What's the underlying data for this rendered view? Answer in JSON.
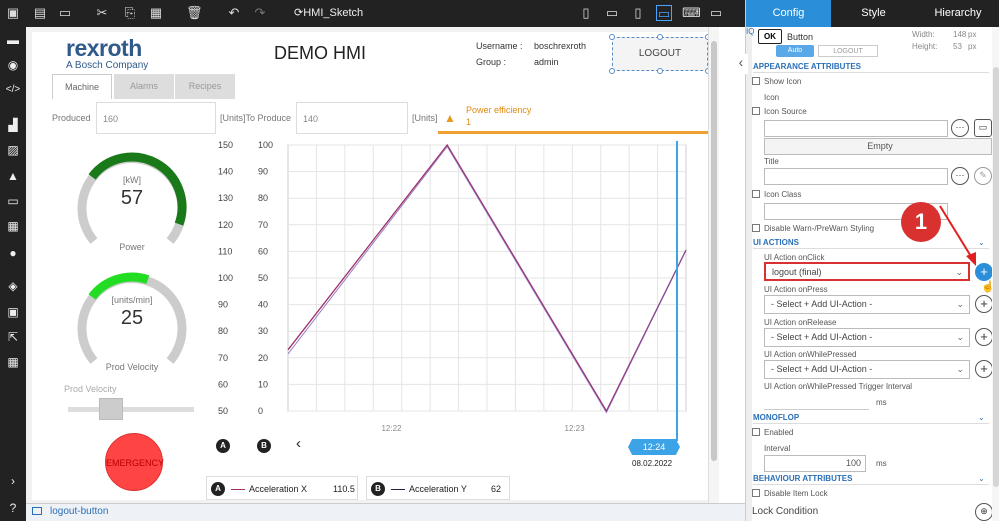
{
  "toolbar": {
    "project_name": "HMI_Sketch",
    "icons": [
      "save-icon",
      "save-all-icon",
      "monitor-icon",
      "cut-icon",
      "copy-icon",
      "delete-icon",
      "undo-icon",
      "redo-icon"
    ],
    "device_icons": [
      "phone-portrait-icon",
      "phone-landscape-icon",
      "tablet-portrait-icon",
      "tablet-landscape-icon",
      "laptop-icon",
      "desktop-icon"
    ]
  },
  "sidebar": {
    "icons": [
      "dashboard-icon",
      "globe-icon",
      "code-icon",
      "factory-icon",
      "chart-icon",
      "warning-icon",
      "card-icon",
      "user-icon",
      "cube-icon",
      "devices-icon",
      "export-icon",
      "grid-icon",
      "chevron-right-icon",
      "help-icon"
    ]
  },
  "hmi": {
    "logo_text": "rexroth",
    "logo_sub": "A Bosch Company",
    "title": "DEMO HMI",
    "username_label": "Username :",
    "username_value": "boschrexroth",
    "group_label": "Group :",
    "group_value": "admin",
    "logout_label": "LOGOUT",
    "tabs": [
      "Machine",
      "Alarms",
      "Recipes"
    ],
    "produced_label": "Produced",
    "produced_value": "160",
    "units_to_produce_label": "[Units]To Produce",
    "to_produce_value": "140",
    "units_label": "[Units]",
    "alert_title": "Power efficiency",
    "alert_value": "1",
    "gauge1": {
      "unit": "[kW]",
      "value": "57",
      "label": "Power",
      "fraction": 0.57,
      "color": "#1a7a1a"
    },
    "gauge2": {
      "unit": "[units/min]",
      "value": "25",
      "label": "Prod Velocity",
      "fraction": 0.25,
      "color": "#22dd22"
    },
    "slider_label": "Prod Velocity",
    "slider_fraction": 0.3,
    "emergency_label": "EMERGENCY",
    "chart_time_label": "12:24",
    "chart_date": "08.02.2022",
    "legend": [
      {
        "badge": "A",
        "name": "Acceleration X",
        "value": "110.5",
        "color": "#a0306a"
      },
      {
        "badge": "B",
        "name": "Acceleration Y",
        "value": "62",
        "color": "#222244"
      }
    ],
    "badge_a": "A",
    "badge_b": "B",
    "nav_prev": "‹"
  },
  "chart_data": {
    "type": "line",
    "x_ticks": [
      "12:22",
      "12:23"
    ],
    "y_left_ticks": [
      "150",
      "140",
      "130",
      "120",
      "110",
      "100",
      "90",
      "80",
      "70",
      "60",
      "50"
    ],
    "y_right_ticks": [
      "100",
      "90",
      "80",
      "70",
      "60",
      "50",
      "40",
      "30",
      "20",
      "10",
      "0"
    ],
    "ylim_left": [
      50,
      150
    ],
    "ylim_right": [
      0,
      100
    ],
    "series": [
      {
        "name": "Acceleration X",
        "x": [
          0,
          0.4,
          0.8,
          1.0
        ],
        "values": [
          73,
          150,
          50,
          110.5
        ]
      },
      {
        "name": "Acceleration Y",
        "x": [
          0,
          0.4,
          0.8,
          1.0
        ],
        "values": [
          22,
          100,
          0,
          61
        ]
      }
    ]
  },
  "status": {
    "selected": "logout-button"
  },
  "panel": {
    "tabs": [
      "Config",
      "Style",
      "Hierarchy"
    ],
    "element_badge": "OK",
    "element_type": "Button",
    "width_label": "Width:",
    "width_value": "148",
    "width_unit": "px",
    "height_label": "Height:",
    "height_value": "53",
    "height_unit": "px",
    "appearance_header": "APPEARANCE ATTRIBUTES",
    "show_icon": "Show Icon",
    "icon_label": "Icon",
    "icon_source": "Icon Source",
    "empty_label": "Empty",
    "title_label": "Title",
    "icon_class": "Icon Class",
    "disable_warn": "Disable Warn-/PreWarn Styling",
    "ui_actions_header": "UI ACTIONS",
    "on_click_label": "UI Action onClick",
    "on_click_value": "logout (final)",
    "on_press_label": "UI Action onPress",
    "on_release_label": "UI Action onRelease",
    "on_while_label": "UI Action onWhilePressed",
    "select_placeholder": "- Select + Add UI-Action -",
    "trigger_interval": "UI Action onWhilePressed Trigger Interval",
    "ms": "ms",
    "monoflop_header": "MONOFLOP",
    "enabled_label": "Enabled",
    "interval_label": "Interval",
    "interval_value": "100",
    "behaviour_header": "BEHAVIOUR ATTRIBUTES",
    "disable_lock": "Disable Item Lock",
    "lock_condition": "Lock Condition",
    "step_number": "1",
    "top_tab_auto": "Auto",
    "top_tab_logout": "LOGOUT"
  }
}
